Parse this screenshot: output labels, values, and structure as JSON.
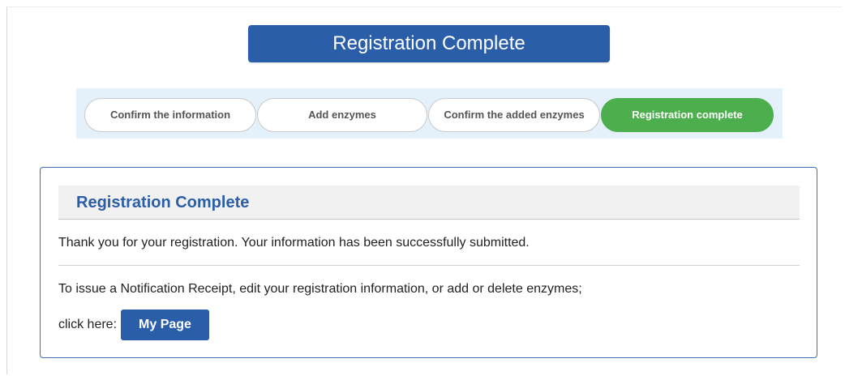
{
  "header": {
    "title": "Registration Complete"
  },
  "steps": [
    {
      "label": "Confirm the information",
      "active": false
    },
    {
      "label": "Add enzymes",
      "active": false
    },
    {
      "label": "Confirm the added enzymes",
      "active": false
    },
    {
      "label": "Registration complete",
      "active": true
    }
  ],
  "panel": {
    "title": "Registration Complete",
    "message": "Thank you for your registration. Your information has been successfully submitted.",
    "instruction": "To issue a Notification Receipt, edit your registration information, or add or delete enzymes;",
    "click_label": "click here:",
    "my_page_button": "My Page"
  },
  "colors": {
    "primary": "#2a5ea9",
    "active_step": "#4cae4c",
    "steps_background": "#e4f1fb"
  }
}
